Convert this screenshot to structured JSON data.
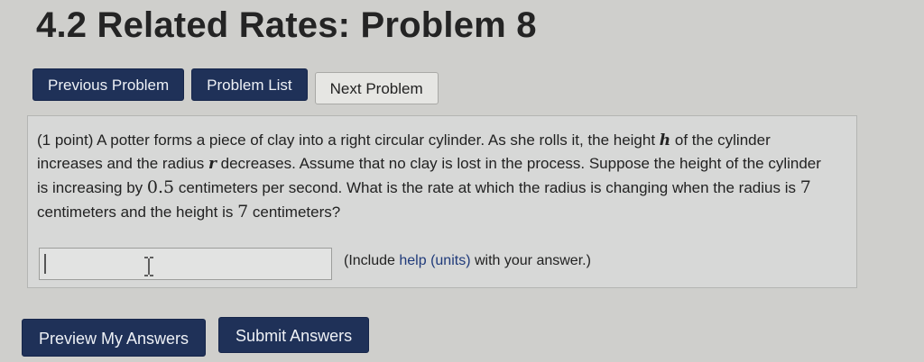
{
  "page": {
    "title": "4.2 Related Rates: Problem 8"
  },
  "nav": {
    "previous_label": "Previous Problem",
    "list_label": "Problem List",
    "next_label": "Next Problem"
  },
  "problem": {
    "points": "(1 point)",
    "text_1": " A potter forms a piece of clay into a right circular cylinder. As she rolls it, the height ",
    "var_h": "h",
    "text_2": " of the cylinder increases and the radius ",
    "var_r": "r",
    "text_3": " decreases. Assume that no clay is lost in the process. Suppose the height of the cylinder is increasing by ",
    "rate": "0.5",
    "text_4": " centimeters per second. What is the rate at which the radius is changing when the radius is ",
    "radius_value": "7",
    "text_5": " centimeters and the height is ",
    "height_value": "7",
    "text_6": " centimeters?"
  },
  "answer": {
    "value": "",
    "note_prefix": "(Include ",
    "help_link": "help (units)",
    "note_suffix": " with your answer.)"
  },
  "actions": {
    "preview_label": "Preview My Answers",
    "submit_label": "Submit Answers"
  },
  "colors": {
    "primary_button": "#1f3158",
    "background": "#cfcfcc"
  },
  "icons": {
    "text_cursor": "i-beam-cursor-icon"
  }
}
